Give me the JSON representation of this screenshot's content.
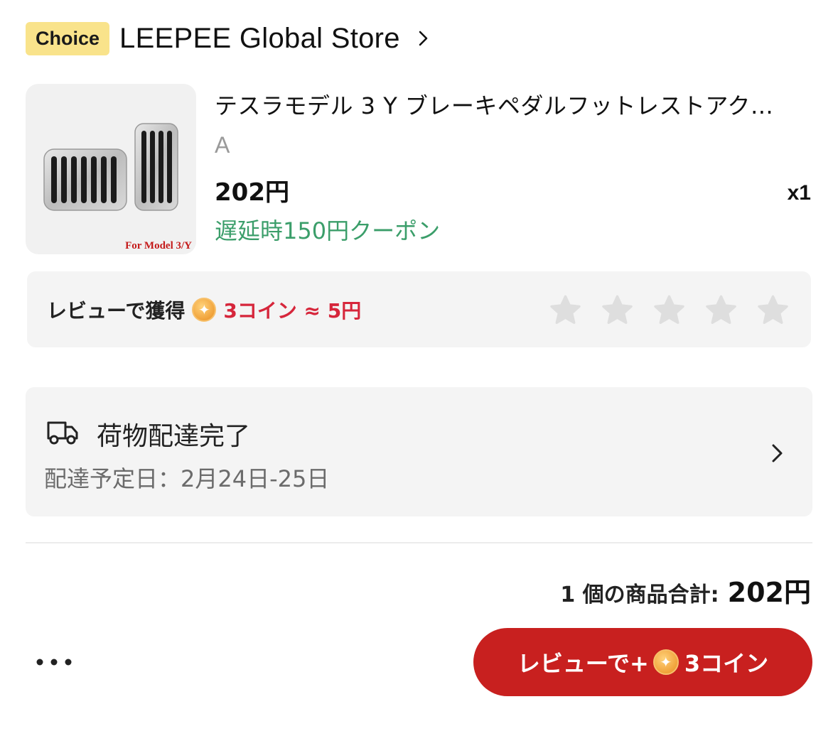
{
  "store": {
    "badge": "Choice",
    "name": "LEEPEE Global Store"
  },
  "product": {
    "title": "テスラモデル 3 Y ブレーキペダルフットレストアク…",
    "variant": "A",
    "price": "202円",
    "coupon": "遅延時150円クーポン",
    "quantity": "x1",
    "image_caption": "For Model 3/Y"
  },
  "review": {
    "label": "レビューで獲得",
    "reward": "3コイン ≈ 5円",
    "stars": 5
  },
  "delivery": {
    "status": "荷物配達完了",
    "date": "配達予定日：2月24日-25日"
  },
  "total": {
    "label": "1 個の商品合計:",
    "value": "202円"
  },
  "actions": {
    "review_button_prefix": "レビューで+",
    "review_button_suffix": "3コイン"
  },
  "colors": {
    "choice_badge": "#f9e38b",
    "coupon_green": "#3b9e6a",
    "reward_red": "#d6263b",
    "button_red": "#c8201f"
  }
}
